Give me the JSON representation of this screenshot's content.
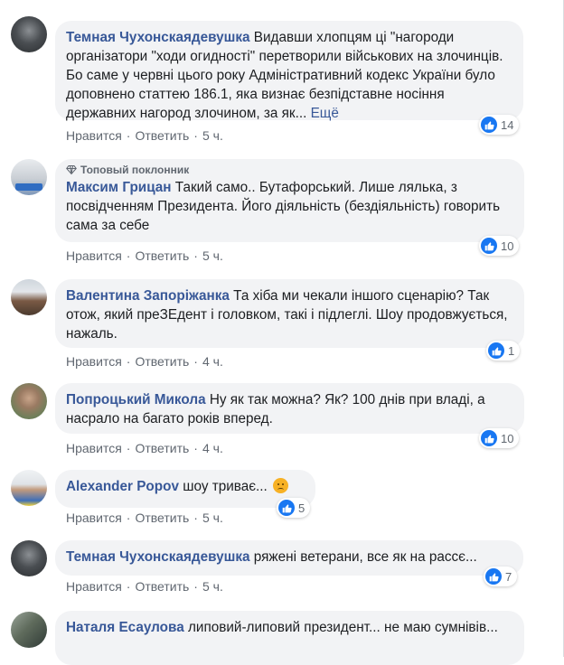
{
  "actions": {
    "like": "Нравится",
    "reply": "Ответить",
    "sep": "·"
  },
  "colors": {
    "author": "#385898",
    "bubble": "#f2f3f5",
    "like": "#1877f2",
    "meta": "#606770"
  },
  "comments": [
    {
      "author": "Темная Чухонскаядевушка",
      "text": "Видавши хлопцям ці \"нагороди організатори \"ходи огидності\" перетворили військових на злочинців. Бо саме у червні цього року Адміністративний кодекс України було доповнено статтею 186.1, яка визнає безпідставне носіння державних нагород злочином, за як...",
      "more": "Ещё",
      "time": "5 ч.",
      "likes": "14"
    },
    {
      "badge": "Топовый поклонник",
      "author": "Максим Грицан",
      "text": "Такий само.. Бутафорський. Лише лялька, з посвідченням Президента. Його діяльність (бездіяльність) говорить сама за себе",
      "time": "5 ч.",
      "likes": "10"
    },
    {
      "author": "Валентина Запоріжанка",
      "text": "Та хіба ми чекали іншого сценарію? Так отож, який преЗЕдент і головком, такі і підлеглі. Шоу продовжується, нажаль.",
      "time": "4 ч.",
      "likes": "1"
    },
    {
      "author": "Попроцький Микола",
      "text": "Ну як так можна? Як? 100 днів при владі, а насрало на багато років вперед.",
      "time": "4 ч.",
      "likes": "10"
    },
    {
      "author": "Alexander Popov",
      "text": "шоу триває...",
      "emoji": "sad-face-emoji",
      "time": "5 ч.",
      "likes": "5"
    },
    {
      "author": "Темная Чухонскаядевушка",
      "text": "ряжені ветерани, все як на рассє...",
      "time": "5 ч.",
      "likes": "7"
    },
    {
      "author": "Наталя Есаулова",
      "text": "липовий-липовий президент... не маю сумнівів..."
    }
  ]
}
